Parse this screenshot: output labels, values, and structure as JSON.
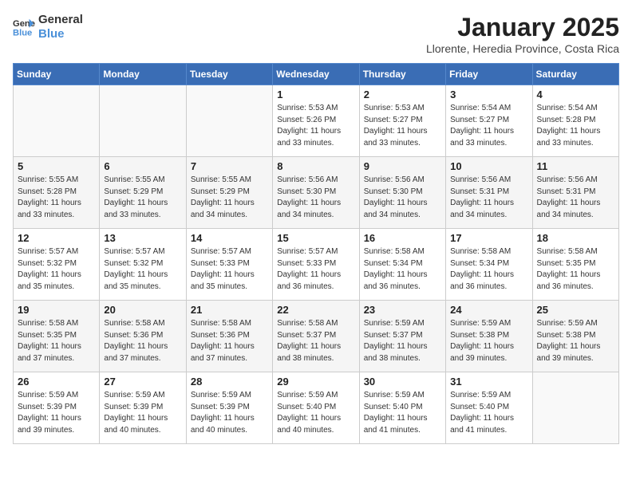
{
  "logo": {
    "text_general": "General",
    "text_blue": "Blue"
  },
  "header": {
    "month_title": "January 2025",
    "subtitle": "Llorente, Heredia Province, Costa Rica"
  },
  "days_of_week": [
    "Sunday",
    "Monday",
    "Tuesday",
    "Wednesday",
    "Thursday",
    "Friday",
    "Saturday"
  ],
  "weeks": [
    [
      {
        "day": "",
        "info": ""
      },
      {
        "day": "",
        "info": ""
      },
      {
        "day": "",
        "info": ""
      },
      {
        "day": "1",
        "info": "Sunrise: 5:53 AM\nSunset: 5:26 PM\nDaylight: 11 hours\nand 33 minutes."
      },
      {
        "day": "2",
        "info": "Sunrise: 5:53 AM\nSunset: 5:27 PM\nDaylight: 11 hours\nand 33 minutes."
      },
      {
        "day": "3",
        "info": "Sunrise: 5:54 AM\nSunset: 5:27 PM\nDaylight: 11 hours\nand 33 minutes."
      },
      {
        "day": "4",
        "info": "Sunrise: 5:54 AM\nSunset: 5:28 PM\nDaylight: 11 hours\nand 33 minutes."
      }
    ],
    [
      {
        "day": "5",
        "info": "Sunrise: 5:55 AM\nSunset: 5:28 PM\nDaylight: 11 hours\nand 33 minutes."
      },
      {
        "day": "6",
        "info": "Sunrise: 5:55 AM\nSunset: 5:29 PM\nDaylight: 11 hours\nand 33 minutes."
      },
      {
        "day": "7",
        "info": "Sunrise: 5:55 AM\nSunset: 5:29 PM\nDaylight: 11 hours\nand 34 minutes."
      },
      {
        "day": "8",
        "info": "Sunrise: 5:56 AM\nSunset: 5:30 PM\nDaylight: 11 hours\nand 34 minutes."
      },
      {
        "day": "9",
        "info": "Sunrise: 5:56 AM\nSunset: 5:30 PM\nDaylight: 11 hours\nand 34 minutes."
      },
      {
        "day": "10",
        "info": "Sunrise: 5:56 AM\nSunset: 5:31 PM\nDaylight: 11 hours\nand 34 minutes."
      },
      {
        "day": "11",
        "info": "Sunrise: 5:56 AM\nSunset: 5:31 PM\nDaylight: 11 hours\nand 34 minutes."
      }
    ],
    [
      {
        "day": "12",
        "info": "Sunrise: 5:57 AM\nSunset: 5:32 PM\nDaylight: 11 hours\nand 35 minutes."
      },
      {
        "day": "13",
        "info": "Sunrise: 5:57 AM\nSunset: 5:32 PM\nDaylight: 11 hours\nand 35 minutes."
      },
      {
        "day": "14",
        "info": "Sunrise: 5:57 AM\nSunset: 5:33 PM\nDaylight: 11 hours\nand 35 minutes."
      },
      {
        "day": "15",
        "info": "Sunrise: 5:57 AM\nSunset: 5:33 PM\nDaylight: 11 hours\nand 36 minutes."
      },
      {
        "day": "16",
        "info": "Sunrise: 5:58 AM\nSunset: 5:34 PM\nDaylight: 11 hours\nand 36 minutes."
      },
      {
        "day": "17",
        "info": "Sunrise: 5:58 AM\nSunset: 5:34 PM\nDaylight: 11 hours\nand 36 minutes."
      },
      {
        "day": "18",
        "info": "Sunrise: 5:58 AM\nSunset: 5:35 PM\nDaylight: 11 hours\nand 36 minutes."
      }
    ],
    [
      {
        "day": "19",
        "info": "Sunrise: 5:58 AM\nSunset: 5:35 PM\nDaylight: 11 hours\nand 37 minutes."
      },
      {
        "day": "20",
        "info": "Sunrise: 5:58 AM\nSunset: 5:36 PM\nDaylight: 11 hours\nand 37 minutes."
      },
      {
        "day": "21",
        "info": "Sunrise: 5:58 AM\nSunset: 5:36 PM\nDaylight: 11 hours\nand 37 minutes."
      },
      {
        "day": "22",
        "info": "Sunrise: 5:58 AM\nSunset: 5:37 PM\nDaylight: 11 hours\nand 38 minutes."
      },
      {
        "day": "23",
        "info": "Sunrise: 5:59 AM\nSunset: 5:37 PM\nDaylight: 11 hours\nand 38 minutes."
      },
      {
        "day": "24",
        "info": "Sunrise: 5:59 AM\nSunset: 5:38 PM\nDaylight: 11 hours\nand 39 minutes."
      },
      {
        "day": "25",
        "info": "Sunrise: 5:59 AM\nSunset: 5:38 PM\nDaylight: 11 hours\nand 39 minutes."
      }
    ],
    [
      {
        "day": "26",
        "info": "Sunrise: 5:59 AM\nSunset: 5:39 PM\nDaylight: 11 hours\nand 39 minutes."
      },
      {
        "day": "27",
        "info": "Sunrise: 5:59 AM\nSunset: 5:39 PM\nDaylight: 11 hours\nand 40 minutes."
      },
      {
        "day": "28",
        "info": "Sunrise: 5:59 AM\nSunset: 5:39 PM\nDaylight: 11 hours\nand 40 minutes."
      },
      {
        "day": "29",
        "info": "Sunrise: 5:59 AM\nSunset: 5:40 PM\nDaylight: 11 hours\nand 40 minutes."
      },
      {
        "day": "30",
        "info": "Sunrise: 5:59 AM\nSunset: 5:40 PM\nDaylight: 11 hours\nand 41 minutes."
      },
      {
        "day": "31",
        "info": "Sunrise: 5:59 AM\nSunset: 5:40 PM\nDaylight: 11 hours\nand 41 minutes."
      },
      {
        "day": "",
        "info": ""
      }
    ]
  ]
}
